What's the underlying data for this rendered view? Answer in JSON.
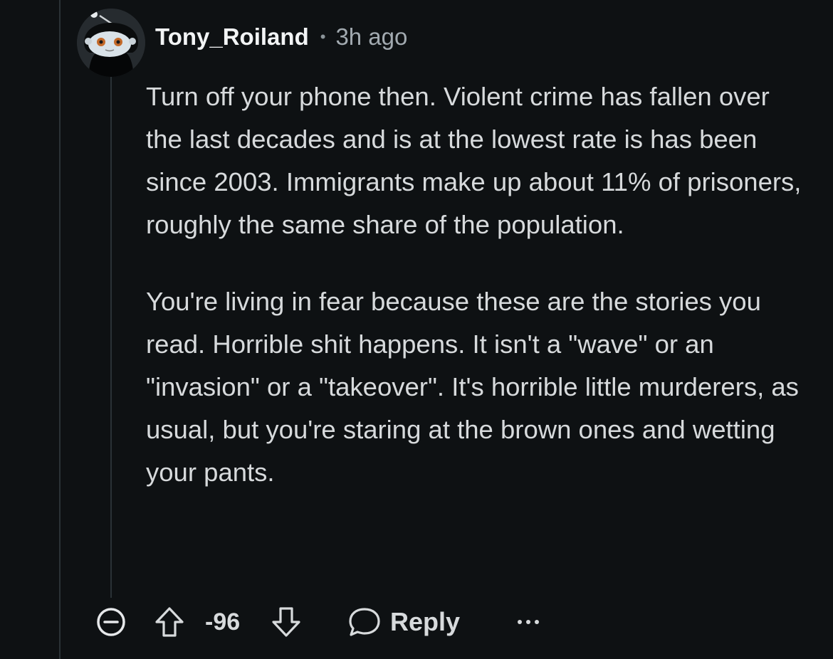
{
  "comment": {
    "username": "Tony_Roiland",
    "separator": "•",
    "timestamp": "3h ago",
    "paragraphs": [
      "Turn off your phone then. Violent crime has fallen over the last decades and is at the lowest rate is has been since 2003. Immigrants make up about 11% of prisoners, roughly the same share of the population.",
      "You're living in fear because these are the stories you read. Horrible shit happens. It isn't a \"wave\" or an \"invasion\" or a \"takeover\". It's horrible little murderers, as usual, but you're staring at the brown ones and wetting your pants."
    ]
  },
  "actions": {
    "score": "-96",
    "reply_label": "Reply"
  },
  "icons": {
    "collapse": "collapse-minus-circle-icon",
    "upvote": "upvote-arrow-icon",
    "downvote": "downvote-arrow-icon",
    "reply": "chat-bubble-icon",
    "more": "more-options-icon"
  },
  "colors": {
    "background": "#0e1113",
    "text": "#d7dadc",
    "thread_line": "#2a3236"
  }
}
